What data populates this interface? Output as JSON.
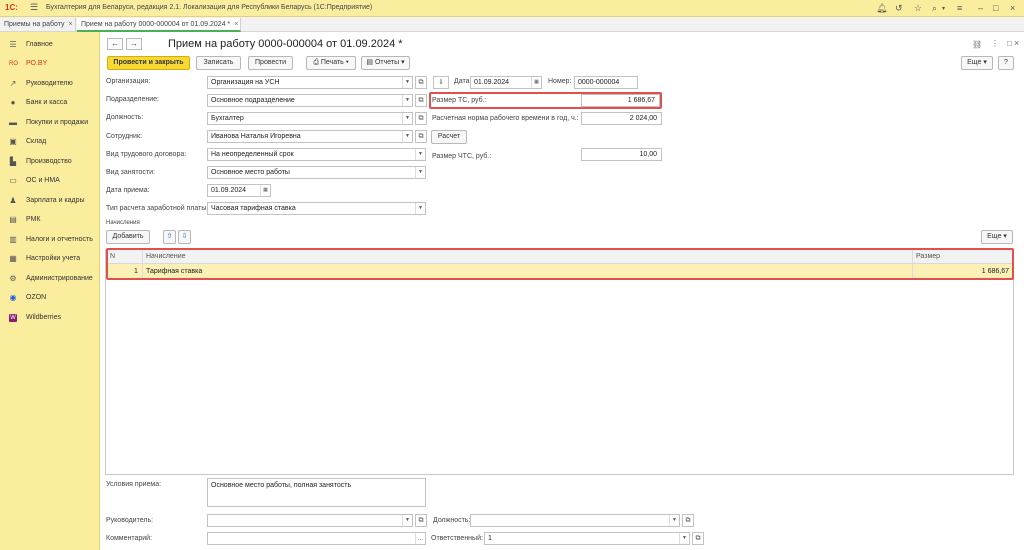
{
  "app": {
    "logo": "1С:",
    "title": "Бухгалтерия для Беларуси, редакция 2.1. Локализация для Республики Беларусь   (1С:Предприятие)"
  },
  "tabs": [
    {
      "label": "Приемы на работу",
      "close": "×"
    },
    {
      "label": "Прием на работу 0000-000004 от 01.09.2024 *",
      "close": "×"
    }
  ],
  "sidebar": {
    "items": [
      {
        "label": "Главное",
        "icon": "menu-icon"
      },
      {
        "label": "РО.BY",
        "icon": "ro-by-icon"
      },
      {
        "label": "Руководителю",
        "icon": "chart-icon"
      },
      {
        "label": "Банк и касса",
        "icon": "bank-icon"
      },
      {
        "label": "Покупки и продажи",
        "icon": "cart-icon"
      },
      {
        "label": "Склад",
        "icon": "warehouse-icon"
      },
      {
        "label": "Производство",
        "icon": "factory-icon"
      },
      {
        "label": "ОС и НМА",
        "icon": "truck-icon"
      },
      {
        "label": "Зарплата и кадры",
        "icon": "people-icon"
      },
      {
        "label": "РМК",
        "icon": "cash-register-icon"
      },
      {
        "label": "Налоги и отчетность",
        "icon": "tax-icon"
      },
      {
        "label": "Настройки учета",
        "icon": "settings-doc-icon"
      },
      {
        "label": "Администрирование",
        "icon": "gear-icon"
      },
      {
        "label": "OZON",
        "icon": "ozon-icon"
      },
      {
        "label": "Wildberries",
        "icon": "wildberries-icon"
      }
    ]
  },
  "doc": {
    "title": "Прием на работу 0000-000004 от 01.09.2024 *"
  },
  "toolbar": {
    "post_close": "Провести и закрыть",
    "save": "Записать",
    "post": "Провести",
    "print": "Печать",
    "reports": "Отчеты",
    "more": "Еще"
  },
  "form": {
    "org_label": "Организация:",
    "org_value": "Организация на УСН",
    "dept_label": "Подразделение:",
    "dept_value": "Основное подразделение",
    "pos_label": "Должность:",
    "pos_value": "Бухгалтер",
    "emp_label": "Сотрудник:",
    "emp_value": "Иванова Наталья Игоревна",
    "contract_label": "Вид трудового договора:",
    "contract_value": "На неопределенный срок",
    "employment_label": "Вид занятости:",
    "employment_value": "Основное место работы",
    "hire_date_label": "Дата приема:",
    "hire_date_value": "01.09.2024",
    "salary_type_label": "Тип расчета заработной платы:",
    "salary_type_value": "Часовая тарифная ставка",
    "date_label": "Дата:",
    "date_value": "01.09.2024",
    "number_label": "Номер:",
    "number_value": "0000-000004",
    "ts_label": "Размер ТС, руб.:",
    "ts_value": "1 686,67",
    "norm_label": "Расчетная норма рабочего времени в год, ч.:",
    "norm_value": "2 024,00",
    "calc_button": "Расчет",
    "chts_label": "Размер ЧТС, руб.:",
    "chts_value": "10,00"
  },
  "accruals": {
    "section_label": "Начисления",
    "add_button": "Добавить",
    "more": "Еще",
    "columns": {
      "n": "N",
      "accrual": "Начисление",
      "amount": "Размер"
    },
    "rows": [
      {
        "n": "1",
        "accrual": "Тарифная ставка",
        "amount": "1 686,67"
      }
    ]
  },
  "footer": {
    "conditions_label": "Условия приема:",
    "conditions_value": "Основное место работы, полная занятость",
    "manager_label": "Руководитель:",
    "manager_value": "",
    "position_label": "Должность:",
    "position_value": "",
    "comment_label": "Комментарий:",
    "comment_value": "",
    "responsible_label": "Ответственный:",
    "responsible_value": "1"
  },
  "colors": {
    "accent": "#f9d835",
    "sidebar_bg": "#fbed9e",
    "highlight_row": "#fbf0b6",
    "annotation_red": "#e05050",
    "active_tab_line": "#4caf50"
  }
}
